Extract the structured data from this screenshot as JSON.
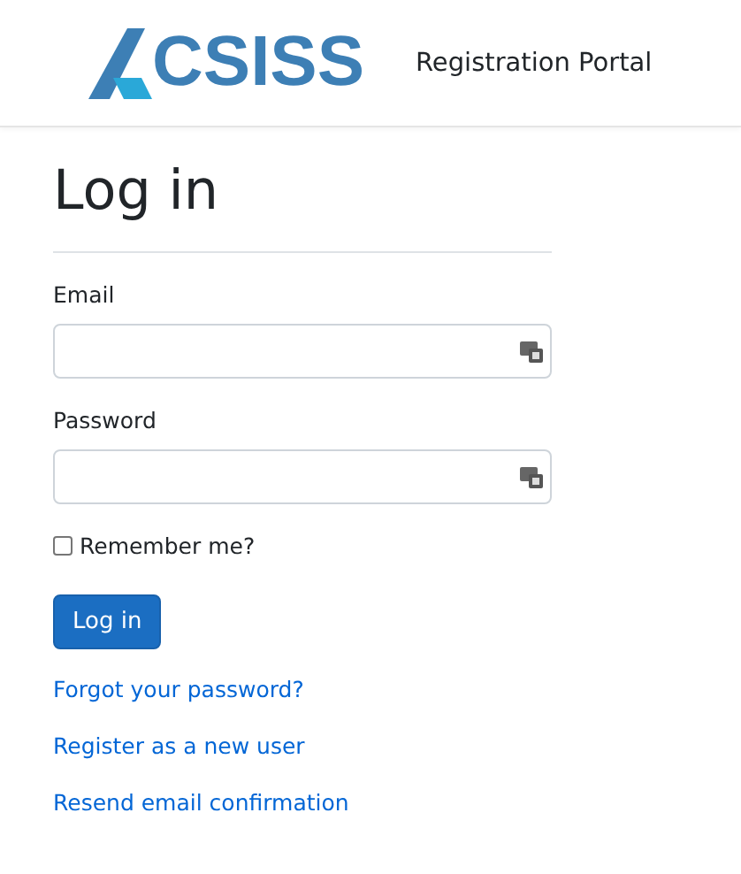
{
  "header": {
    "brand": "CSISS",
    "title": "Registration Portal"
  },
  "page_title": "Log in",
  "fields": [
    {
      "label": "Email"
    },
    {
      "label": "Password"
    }
  ],
  "remember": {
    "label": "Remember me?",
    "checked": false
  },
  "submit": "Log in",
  "links": [
    "Forgot your password?",
    "Register as a new user",
    "Resend email confirmation"
  ]
}
